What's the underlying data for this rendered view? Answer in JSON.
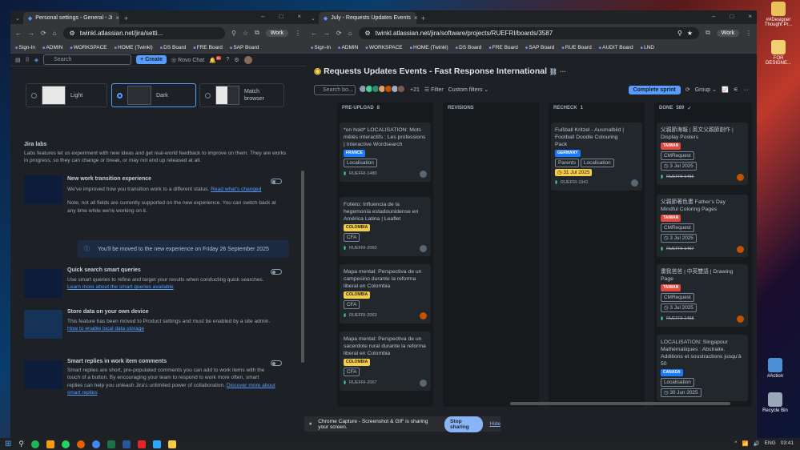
{
  "left_window": {
    "tab_title": "Personal settings - General - Ji",
    "url": "twinkl.atlassian.net/jira/setti...",
    "profile": "Work",
    "bookmarks": [
      "Sign-In",
      "ADMIN",
      "WORKSPACE",
      "HOME (Twinkl)",
      "DS Board",
      "FRE Board",
      "SAP Board"
    ],
    "search_placeholder": "Search",
    "create": "Create",
    "rovo": "Rovo Chat",
    "notif_count": "9+",
    "themes": [
      "Light",
      "Dark",
      "Match browser"
    ],
    "labs_title": "Jira labs",
    "labs_desc": "Labs features let us experiment with new ideas and get real-world feedback to improve on them. They are works in progress, so they can change or break, or may not end up released at all.",
    "features": [
      {
        "title": "New work transition experience",
        "desc": "We've improved how you transition work to a different status.",
        "link": "Read what's changed",
        "note": "Note, not all fields are currently supported on the new experience. You can switch back at any time while we're working on it."
      },
      {
        "title": "Quick search smart queries",
        "desc": "Use smart queries to refine and target your results when conducting quick searches.",
        "link": "Learn more about the smart queries available"
      },
      {
        "title": "Store data on your own device",
        "desc": "This feature has been moved to Product settings and must be enabled by a site admin.",
        "link": "How to enable local data storage"
      },
      {
        "title": "Smart replies in work item comments",
        "desc": "Smart replies are short, pre-populated comments you can add to work items with the touch of a button. By encouraging your team to respond to work more often, smart replies can help you unleash Jira's unlimited power of collaboration.",
        "link": "Discover more about smart replies"
      }
    ],
    "info_banner": "You'll be moved to the new experience on Friday 26 September 2025"
  },
  "right_window": {
    "tab_title": "July - Requests Updates Events",
    "url": "twinkl.atlassian.net/jira/software/projects/RUEFRI/boards/3587",
    "profile": "Work",
    "bookmarks": [
      "Sign-In",
      "ADMIN",
      "WORKSPACE",
      "HOME (Twinkl)",
      "DS Board",
      "FRE Board",
      "SAP Board",
      "RUE Board",
      "AUDIT Board",
      "LND"
    ],
    "board_title": "Requests Updates Events - Fast Response International",
    "search_placeholder": "Search bo...",
    "avatar_more": "+21",
    "filter": "Filter",
    "custom_filters": "Custom filters",
    "complete_sprint": "Complete sprint",
    "group": "Group",
    "columns": [
      {
        "name": "PRE-UPLOAD",
        "count": "8"
      },
      {
        "name": "REVISIONS",
        "count": ""
      },
      {
        "name": "RECHECK",
        "count": "1"
      },
      {
        "name": "DONE",
        "count": "589"
      }
    ],
    "preupload_cards": [
      {
        "title": "*on hold* LOCALISATION: Mots mêlés interactifs : Les professions | Interactive Wordsearch",
        "tag": "FRANCE",
        "chip": "Localisation",
        "key": "RUEFRI-1480"
      },
      {
        "title": "Folleto: Influencia de la hegemonía estadounidense en América Latina | Leaflet",
        "tag": "COLOMBIA",
        "chip": "CFA",
        "key": "RUEFRI-2060"
      },
      {
        "title": "Mapa mental: Perspectiva de un campesino durante la reforma liberal en Colombia",
        "tag": "COLOMBIA",
        "chip": "CFA",
        "key": "RUEFRI-2063"
      },
      {
        "title": "Mapa mental: Perspectiva de un sacerdote rural durante la reforma liberal en Colombia",
        "tag": "COLOMBIA",
        "chip": "CFA",
        "key": "RUEFRI-2067"
      }
    ],
    "recheck_card": {
      "title": "Fußball Kritzel - Ausmalbild | Football Doodle Colouring Pack",
      "tag": "GERMANY",
      "chip1": "Parents",
      "chip2": "Localisation",
      "date": "31 Jul 2025",
      "key": "RUEFRI-1941"
    },
    "done_cards": [
      {
        "title": "父親節海報 | 英文父親節創作 | Display Posters",
        "tag": "TAIWAN",
        "chip": "CMRequest",
        "date": "3 Jul 2025",
        "key": "RUEFRI-1456"
      },
      {
        "title": "父親節著色畫 Father's Day Mindful Coloring Pages",
        "tag": "TAIWAN",
        "chip": "CMRequest",
        "date": "3 Jul 2025",
        "key": "RUEFRI-1457"
      },
      {
        "title": "畫我爸爸 | 中英雙語 | Drawing Page",
        "tag": "TAIWAN",
        "chip": "CMRequest",
        "date": "3 Jul 2025",
        "key": "RUEFRI-1458"
      },
      {
        "title": "LOCALISATION: Singapour Mathématiques : Abstraite. Additions et soustractions jusqu'à 50",
        "tag": "CANADA",
        "chip": "Localisation",
        "date": "30 Jun 2025",
        "key": ""
      }
    ]
  },
  "share_bar": {
    "text": "Chrome Capture - Screenshot & GIF is sharing your screen.",
    "stop": "Stop sharing",
    "hide": "Hide"
  },
  "taskbar": {
    "lang": "ENG",
    "time": "03:41"
  },
  "desktop_icons": [
    "##Designer Thought Pr...",
    "FOR DESIGNE...",
    "#Action",
    "Recycle Bin"
  ]
}
